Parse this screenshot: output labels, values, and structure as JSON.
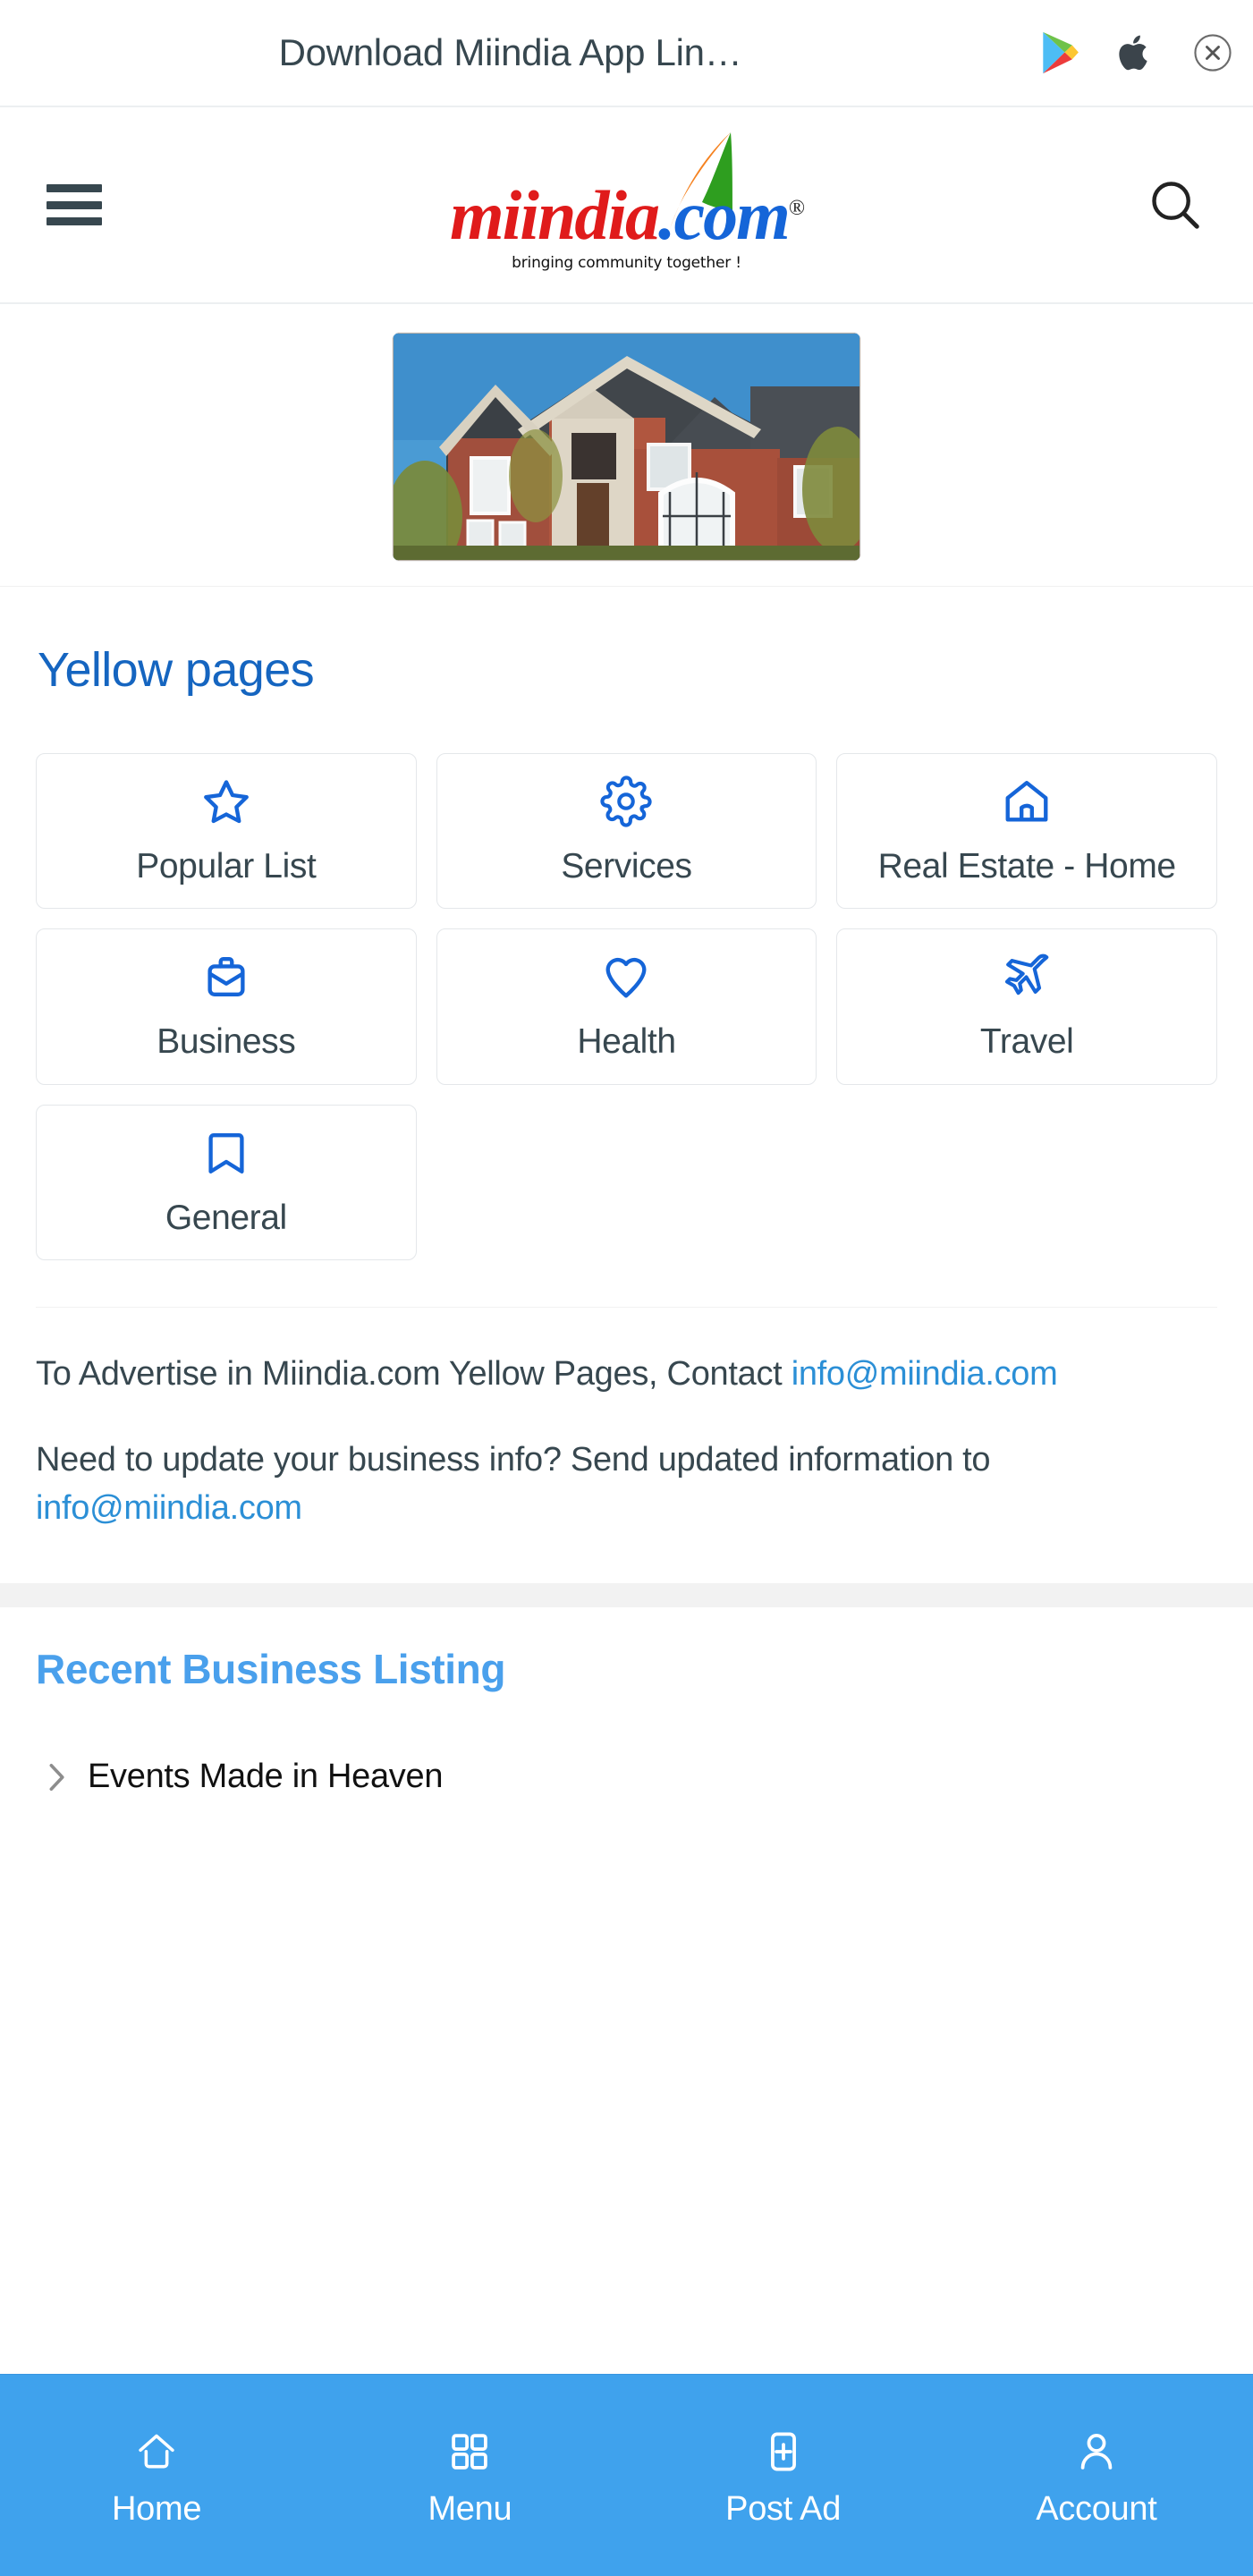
{
  "app_banner": {
    "title": "Download Miindia App Lin…",
    "play_icon": "google-play-icon",
    "apple_icon": "apple-icon",
    "close_icon": "close-circle-icon"
  },
  "header": {
    "menu_icon": "hamburger-menu-icon",
    "brand_primary": "miindia",
    "brand_secondary": ".com",
    "brand_registered": "®",
    "tagline": "bringing community together !",
    "search_icon": "search-icon"
  },
  "ad": {
    "alt": "real-estate-house-banner-ad"
  },
  "yellow_pages": {
    "title": "Yellow pages",
    "cards": [
      {
        "label": "Popular List",
        "icon": "star-icon"
      },
      {
        "label": "Services",
        "icon": "gear-icon"
      },
      {
        "label": "Real Estate - Home",
        "icon": "home-icon"
      },
      {
        "label": "Business",
        "icon": "briefcase-icon"
      },
      {
        "label": "Health",
        "icon": "heart-icon"
      },
      {
        "label": "Travel",
        "icon": "airplane-icon"
      },
      {
        "label": "General",
        "icon": "bookmark-icon"
      }
    ]
  },
  "info": {
    "advertise_text": "To Advertise in Miindia.com Yellow Pages, Contact ",
    "advertise_email": "info@miindia.com",
    "update_text": "Need to update your business info? Send updated information to ",
    "update_email": "info@miindia.com"
  },
  "recent_listing": {
    "title": "Recent Business Listing",
    "items": [
      {
        "label": "Events Made in Heaven",
        "icon": "chevron-right-icon"
      }
    ]
  },
  "bottom_nav": {
    "items": [
      {
        "label": "Home",
        "icon": "home-outline-icon"
      },
      {
        "label": "Menu",
        "icon": "grid-squares-icon"
      },
      {
        "label": "Post Ad",
        "icon": "plus-box-icon"
      },
      {
        "label": "Account",
        "icon": "person-icon"
      }
    ]
  },
  "colors": {
    "brand_red": "#e01b1b",
    "brand_blue": "#1565d8",
    "heading_blue": "#1565c0",
    "section_blue": "#4aa0ec",
    "nav_blue": "#3fa2ed",
    "link_blue": "#2b8fd6",
    "icon_blue": "#1565d8"
  }
}
